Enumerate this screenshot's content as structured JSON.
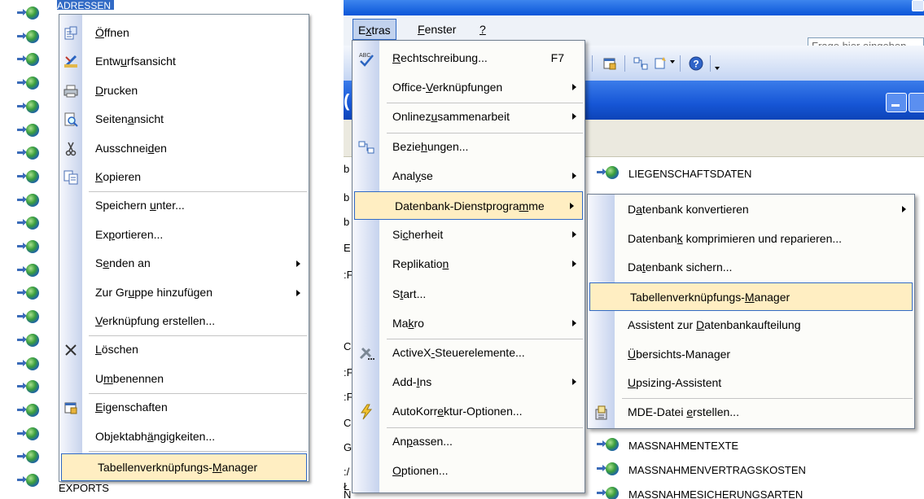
{
  "left": {
    "selected_object_label": "ADRESSEN",
    "bottom_object_label": "EXPORTS",
    "context_menu": {
      "items": [
        {
          "pre": "",
          "u": "Ö",
          "post": "ffnen",
          "icon": "open-icon",
          "arrow": false
        },
        {
          "pre": "Entw",
          "u": "u",
          "post": "rfsansicht",
          "icon": "design-view-icon",
          "arrow": false
        },
        {
          "pre": "",
          "u": "D",
          "post": "rucken",
          "icon": "print-icon",
          "arrow": false
        },
        {
          "pre": "Seiten",
          "u": "a",
          "post": "nsicht",
          "icon": "print-preview-icon",
          "arrow": false
        },
        {
          "pre": "Ausschnei",
          "u": "d",
          "post": "en",
          "icon": "cut-icon",
          "arrow": false
        },
        {
          "pre": "",
          "u": "K",
          "post": "opieren",
          "icon": "copy-icon",
          "arrow": false
        },
        {
          "pre": "Speichern ",
          "u": "u",
          "post": "nter...",
          "icon": "",
          "arrow": false
        },
        {
          "pre": "Ex",
          "u": "p",
          "post": "ortieren...",
          "icon": "",
          "arrow": false
        },
        {
          "pre": "S",
          "u": "e",
          "post": "nden an",
          "icon": "",
          "arrow": true
        },
        {
          "pre": "Zur Gr",
          "u": "u",
          "post": "ppe hinzufügen",
          "icon": "",
          "arrow": true
        },
        {
          "pre": "",
          "u": "V",
          "post": "erknüpfung erstellen...",
          "icon": "",
          "arrow": false
        },
        {
          "pre": "",
          "u": "L",
          "post": "öschen",
          "icon": "delete-icon",
          "arrow": false
        },
        {
          "pre": "U",
          "u": "m",
          "post": "benennen",
          "icon": "",
          "arrow": false
        },
        {
          "pre": "",
          "u": "E",
          "post": "igenschaften",
          "icon": "properties-icon",
          "arrow": false
        },
        {
          "pre": "Objektabh",
          "u": "ä",
          "post": "ngigkeiten...",
          "icon": "",
          "arrow": false
        },
        {
          "pre": "Tabellenverknüpfungs-",
          "u": "M",
          "post": "anager",
          "icon": "",
          "arrow": false
        }
      ]
    }
  },
  "right": {
    "menubar": [
      {
        "pre": "E",
        "u": "x",
        "post": "tras"
      },
      {
        "pre": "",
        "u": "F",
        "post": "enster"
      },
      {
        "pre": "",
        "u": "?",
        "post": ""
      }
    ],
    "help_placeholder": "Frage hier eingeben",
    "side_chars": [
      "b",
      "b",
      "b",
      "E",
      ":F",
      "C",
      ":F",
      ":F",
      "C",
      "G",
      ":/",
      "Ł",
      "N"
    ],
    "objects_top": [
      "LIEGENSCHAFTSDATEN"
    ],
    "objects_bottom": [
      "MASSNAHMENTEXTE",
      "MASSNAHMENVERTRAGSKOSTEN",
      "MASSNAHMESICHERUNGSARTEN"
    ],
    "extras_menu": {
      "items": [
        {
          "pre": "",
          "u": "R",
          "post": "echtschreibung...",
          "shortcut": "F7",
          "icon": "spellcheck-icon",
          "arrow": false
        },
        {
          "pre": "Office-",
          "u": "V",
          "post": "erknüpfungen",
          "shortcut": "",
          "icon": "",
          "arrow": true
        },
        {
          "pre": "Onlinez",
          "u": "u",
          "post": "sammenarbeit",
          "shortcut": "",
          "icon": "",
          "arrow": true
        },
        {
          "pre": "Bezie",
          "u": "h",
          "post": "ungen...",
          "shortcut": "",
          "icon": "relationships-icon",
          "arrow": false
        },
        {
          "pre": "Anal",
          "u": "y",
          "post": "se",
          "shortcut": "",
          "icon": "",
          "arrow": true
        },
        {
          "pre": "Datenbank-Dienstprogra",
          "u": "m",
          "post": "me",
          "shortcut": "",
          "icon": "",
          "arrow": true
        },
        {
          "pre": "Si",
          "u": "c",
          "post": "herheit",
          "shortcut": "",
          "icon": "",
          "arrow": true
        },
        {
          "pre": "Replikatio",
          "u": "n",
          "post": "",
          "shortcut": "",
          "icon": "",
          "arrow": true
        },
        {
          "pre": "S",
          "u": "t",
          "post": "art...",
          "shortcut": "",
          "icon": "",
          "arrow": false
        },
        {
          "pre": "Ma",
          "u": "k",
          "post": "ro",
          "shortcut": "",
          "icon": "",
          "arrow": true
        },
        {
          "pre": "ActiveX",
          "u": "-",
          "post": "Steuerelemente...",
          "shortcut": "",
          "icon": "activex-icon",
          "arrow": false
        },
        {
          "pre": "Add-",
          "u": "I",
          "post": "ns",
          "shortcut": "",
          "icon": "",
          "arrow": true
        },
        {
          "pre": "AutoKorr",
          "u": "e",
          "post": "ktur-Optionen...",
          "shortcut": "",
          "icon": "autocorrect-icon",
          "arrow": false
        },
        {
          "pre": "An",
          "u": "p",
          "post": "assen...",
          "shortcut": "",
          "icon": "",
          "arrow": false
        },
        {
          "pre": "",
          "u": "O",
          "post": "ptionen...",
          "shortcut": "",
          "icon": "",
          "arrow": false
        }
      ]
    },
    "db_utilities_menu": {
      "items": [
        {
          "pre": "D",
          "u": "a",
          "post": "tenbank konvertieren",
          "icon": "",
          "arrow": true
        },
        {
          "pre": "Datenban",
          "u": "k",
          "post": " komprimieren und reparieren...",
          "icon": "",
          "arrow": false
        },
        {
          "pre": "Da",
          "u": "t",
          "post": "enbank sichern...",
          "icon": "",
          "arrow": false
        },
        {
          "pre": "Tabellenverknüpfungs-",
          "u": "M",
          "post": "anager",
          "icon": "",
          "arrow": false
        },
        {
          "pre": "Assistent zur ",
          "u": "D",
          "post": "atenbankaufteilung",
          "icon": "",
          "arrow": false
        },
        {
          "pre": "",
          "u": "Ü",
          "post": "bersichts-Manager",
          "icon": "",
          "arrow": false
        },
        {
          "pre": "",
          "u": "U",
          "post": "psizing-Assistent",
          "icon": "",
          "arrow": false
        },
        {
          "pre": "MDE-Datei ",
          "u": "e",
          "post": "rstellen...",
          "icon": "mde-file-icon",
          "arrow": false
        }
      ]
    }
  }
}
